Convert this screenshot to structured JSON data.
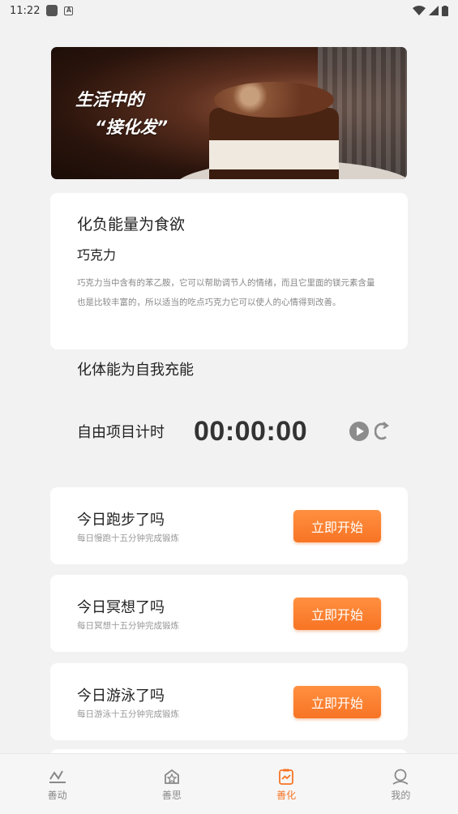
{
  "status": {
    "time": "11:22"
  },
  "banner": {
    "line1": "生活中的",
    "line2": "“接化发”"
  },
  "info": {
    "title": "化负能量为食欲",
    "subtitle": "巧克力",
    "description": "巧克力当中含有的苯乙胺，它可以帮助调节人的情绪，而且它里面的镁元素含量也是比较丰富的，所以适当的吃点巧克力它可以使人的心情得到改善。"
  },
  "section": {
    "title": "化体能为自我充能"
  },
  "timer": {
    "label": "自由项目计时",
    "value": "00:00:00"
  },
  "tasks": [
    {
      "title": "今日跑步了吗",
      "subtitle": "每日慢跑十五分钟完成锻炼",
      "button": "立即开始"
    },
    {
      "title": "今日冥想了吗",
      "subtitle": "每日冥想十五分钟完成锻炼",
      "button": "立即开始"
    },
    {
      "title": "今日游泳了吗",
      "subtitle": "每日游泳十五分钟完成锻炼",
      "button": "立即开始"
    }
  ],
  "tabbar": [
    {
      "label": "善动",
      "icon": "activity-icon",
      "active": false
    },
    {
      "label": "善思",
      "icon": "star-house-icon",
      "active": false
    },
    {
      "label": "善化",
      "icon": "clipboard-chart-icon",
      "active": true
    },
    {
      "label": "我的",
      "icon": "person-icon",
      "active": false
    }
  ],
  "colors": {
    "accent": "#f77424",
    "background": "#f2f2f2"
  }
}
